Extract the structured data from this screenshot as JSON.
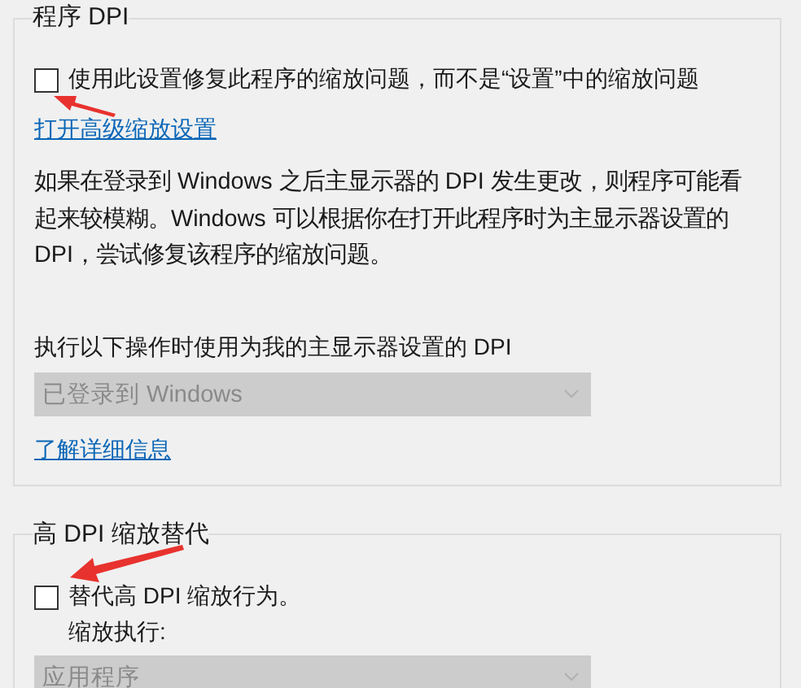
{
  "groups": [
    {
      "title": "程序 DPI",
      "items": [
        {
          "kind": "checkbox",
          "label": "使用此设置修复此程序的缩放问题，而不是“设置”中的缩放问题",
          "checked": false
        },
        {
          "kind": "link",
          "text": "打开高级缩放设置"
        },
        {
          "kind": "paragraph",
          "text": "如果在登录到 Windows 之后主显示器的 DPI 发生更改，则程序可能看起来较模糊。Windows 可以根据你在打开此程序时为主显示器设置的 DPI，尝试修复该程序的缩放问题。"
        },
        {
          "kind": "label",
          "text": "执行以下操作时使用为我的主显示器设置的 DPI"
        },
        {
          "kind": "dropdown",
          "value": "已登录到 Windows",
          "disabled": true
        },
        {
          "kind": "link",
          "text": "了解详细信息"
        }
      ]
    },
    {
      "title": "高 DPI 缩放替代",
      "items": [
        {
          "kind": "checkbox",
          "label": "替代高 DPI 缩放行为。",
          "note": "缩放执行:",
          "checked": false
        },
        {
          "kind": "dropdown",
          "value": "应用程序",
          "disabled": true
        }
      ]
    }
  ]
}
